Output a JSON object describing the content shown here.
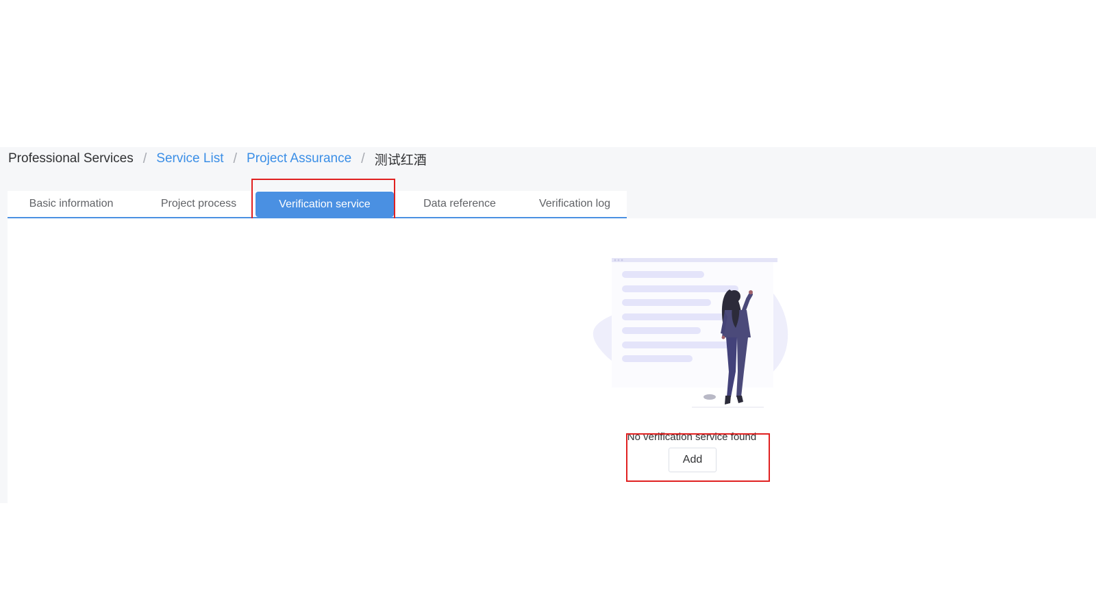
{
  "breadcrumb": {
    "root": "Professional Services",
    "items": [
      "Service List",
      "Project Assurance"
    ],
    "current": "测试红酒",
    "separator": "/"
  },
  "tabs": [
    {
      "label": "Basic information",
      "active": false
    },
    {
      "label": "Project process",
      "active": false
    },
    {
      "label": "Verification service",
      "active": true
    },
    {
      "label": "Data reference",
      "active": false
    },
    {
      "label": "Verification log",
      "active": false
    }
  ],
  "empty_state": {
    "message": "No verification service found",
    "add_label": "Add",
    "illustration": "woman-reading-list-illustration"
  },
  "colors": {
    "accent": "#4a90e2",
    "link": "#3a8ee6",
    "annotation": "#e02020",
    "illustration_blob": "#eeeefb",
    "illustration_lines": "#e4e4fa",
    "figure_suit": "#4b4a7a"
  }
}
